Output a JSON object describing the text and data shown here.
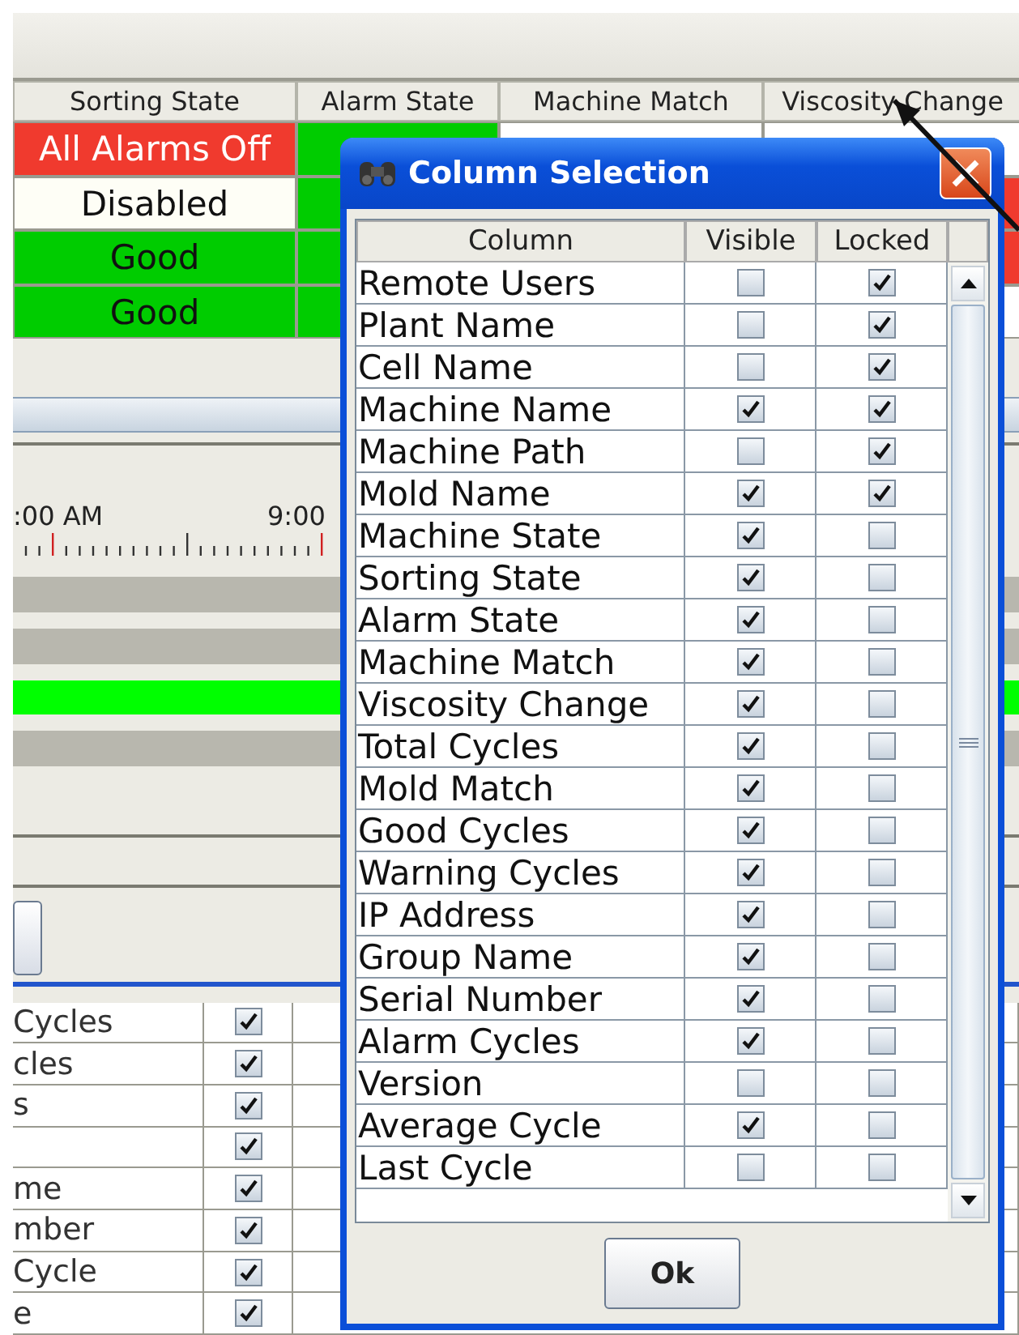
{
  "main_table": {
    "columns": [
      "Sorting State",
      "Alarm State",
      "Machine Match",
      "Viscosity Change"
    ],
    "rows": [
      {
        "cells": [
          {
            "text": "All Alarms Off",
            "color": "#f03a2e"
          },
          {
            "text": "",
            "color": "#00cc00"
          },
          {
            "text": "",
            "color": "#ffffff"
          },
          {
            "text": "",
            "color": "#ffffff"
          }
        ]
      },
      {
        "cells": [
          {
            "text": "Disabled",
            "color": "#fefef6"
          },
          {
            "text": "",
            "color": "#00cc00"
          },
          {
            "text": ""
          },
          {
            "text": "",
            "color": "#f03a2e"
          }
        ]
      },
      {
        "cells": [
          {
            "text": "Good",
            "color": "#00cc00"
          },
          {
            "text": "",
            "color": "#00cc00"
          },
          {
            "text": ""
          },
          {
            "text": "",
            "color": "#f03a2e"
          }
        ]
      },
      {
        "cells": [
          {
            "text": "Good",
            "color": "#00cc00"
          },
          {
            "text": "",
            "color": "#00cc00"
          },
          {
            "text": ""
          },
          {
            "text": "",
            "color": "#ffffff"
          }
        ]
      }
    ]
  },
  "timeline": {
    "labels": [
      ":00 AM",
      "9:00"
    ],
    "bars": [
      {
        "color": "#b8b7ae"
      },
      {
        "color": "#b8b7ae"
      },
      {
        "color": "#00ff00"
      },
      {
        "color": "#b8b7ae"
      }
    ]
  },
  "lower_table": {
    "rows": [
      {
        "label": "Cycles",
        "checked": true
      },
      {
        "label": "cles",
        "checked": true
      },
      {
        "label": "s",
        "checked": true
      },
      {
        "checked": true
      },
      {
        "label": "me",
        "checked": true
      },
      {
        "label": "mber",
        "checked": true
      },
      {
        "label": "Cycle",
        "checked": true
      },
      {
        "label": "e",
        "checked": true
      }
    ]
  },
  "dialog": {
    "title": "Column Selection",
    "columns": [
      "Column",
      "Visible",
      "Locked"
    ],
    "rows": [
      {
        "column": "Remote Users",
        "visible": false,
        "locked": true
      },
      {
        "column": "Plant Name",
        "visible": false,
        "locked": true
      },
      {
        "column": "Cell Name",
        "visible": false,
        "locked": true
      },
      {
        "column": "Machine Name",
        "visible": true,
        "locked": true
      },
      {
        "column": "Machine Path",
        "visible": false,
        "locked": true
      },
      {
        "column": "Mold Name",
        "visible": true,
        "locked": true
      },
      {
        "column": "Machine State",
        "visible": true,
        "locked": false
      },
      {
        "column": "Sorting State",
        "visible": true,
        "locked": false
      },
      {
        "column": "Alarm State",
        "visible": true,
        "locked": false
      },
      {
        "column": "Machine Match",
        "visible": true,
        "locked": false
      },
      {
        "column": "Viscosity Change",
        "visible": true,
        "locked": false
      },
      {
        "column": "Total Cycles",
        "visible": true,
        "locked": false
      },
      {
        "column": "Mold Match",
        "visible": true,
        "locked": false
      },
      {
        "column": "Good Cycles",
        "visible": true,
        "locked": false
      },
      {
        "column": "Warning Cycles",
        "visible": true,
        "locked": false
      },
      {
        "column": "IP Address",
        "visible": true,
        "locked": false
      },
      {
        "column": "Group Name",
        "visible": true,
        "locked": false
      },
      {
        "column": "Serial Number",
        "visible": true,
        "locked": false
      },
      {
        "column": "Alarm Cycles",
        "visible": true,
        "locked": false
      },
      {
        "column": "Version",
        "visible": false,
        "locked": false
      },
      {
        "column": "Average Cycle",
        "visible": true,
        "locked": false
      },
      {
        "column": "Last Cycle",
        "visible": false,
        "locked": false
      }
    ],
    "button": "Ok"
  }
}
